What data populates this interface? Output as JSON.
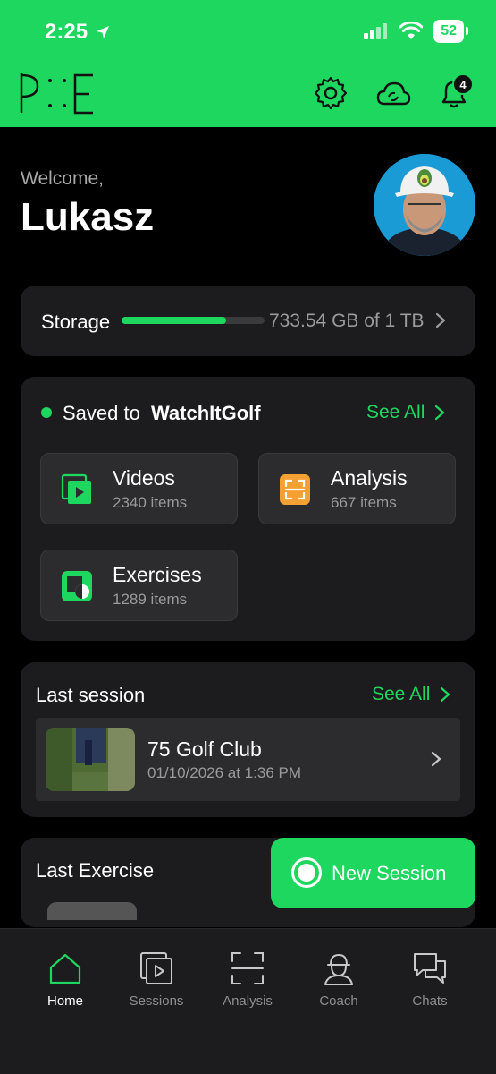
{
  "status_bar": {
    "time": "2:25",
    "battery": "52"
  },
  "header": {
    "notification_count": "4"
  },
  "welcome": {
    "greeting": "Welcome,",
    "name": "Lukasz"
  },
  "storage": {
    "label": "Storage",
    "value": "733.54 GB of 1 TB",
    "used_fraction": 0.73
  },
  "saved": {
    "prefix": "Saved to",
    "name": "WatchItGolf",
    "see_all": "See All",
    "tiles": [
      {
        "title": "Videos",
        "count": "2340 items",
        "icon": "videos-icon"
      },
      {
        "title": "Analysis",
        "count": "667 items",
        "icon": "analysis-icon"
      },
      {
        "title": "Exercises",
        "count": "1289 items",
        "icon": "exercises-icon"
      }
    ]
  },
  "last_session": {
    "title": "Last session",
    "see_all": "See All",
    "item": {
      "name": "75 Golf Club",
      "date": "01/10/2026 at 1:36 PM"
    }
  },
  "last_exercise": {
    "title": "Last Exercise"
  },
  "new_session": {
    "label": "New Session"
  },
  "tabs": [
    {
      "label": "Home",
      "icon": "home-icon",
      "active": true
    },
    {
      "label": "Sessions",
      "icon": "sessions-icon"
    },
    {
      "label": "Analysis",
      "icon": "analysis-icon"
    },
    {
      "label": "Coach",
      "icon": "coach-icon"
    },
    {
      "label": "Chats",
      "icon": "chats-icon"
    }
  ],
  "colors": {
    "accent": "#1ed75f",
    "background": "#000000",
    "card": "#1c1c1e",
    "analysis_orange": "#f5a032"
  }
}
